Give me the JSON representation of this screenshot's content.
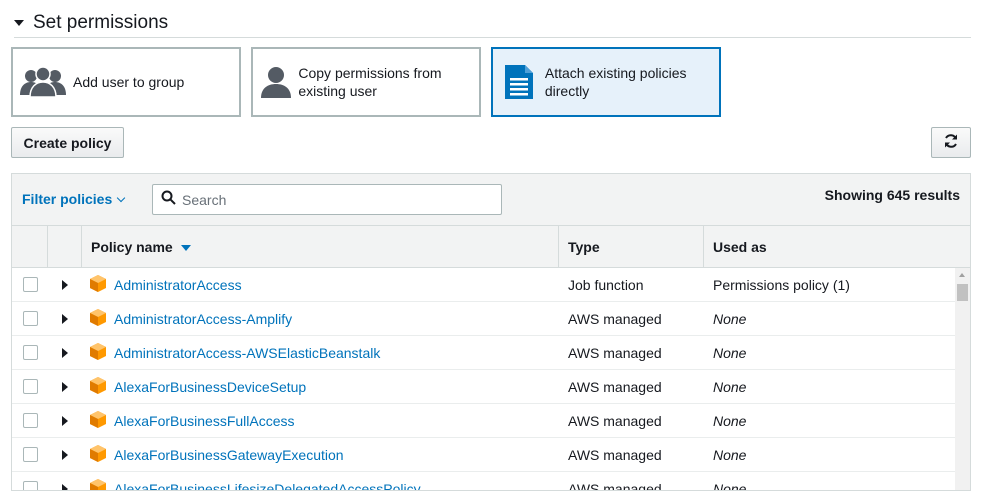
{
  "section": {
    "title": "Set permissions"
  },
  "tiles": [
    {
      "label": "Add user to group",
      "icon": "users-group-icon",
      "selected": false
    },
    {
      "label": "Copy permissions from existing user",
      "icon": "user-icon",
      "selected": false
    },
    {
      "label": "Attach existing policies directly",
      "icon": "document-icon",
      "selected": true
    }
  ],
  "toolbar": {
    "create_label": "Create policy",
    "refresh_icon": "refresh-icon",
    "filter_label": "Filter policies",
    "search_placeholder": "Search",
    "results_text": "Showing 645 results"
  },
  "table": {
    "columns": [
      "Policy name",
      "Type",
      "Used as"
    ],
    "rows": [
      {
        "name": "AdministratorAccess",
        "type": "Job function",
        "used_as": "Permissions policy (1)",
        "used_none": false
      },
      {
        "name": "AdministratorAccess-Amplify",
        "type": "AWS managed",
        "used_as": "None",
        "used_none": true
      },
      {
        "name": "AdministratorAccess-AWSElasticBeanstalk",
        "type": "AWS managed",
        "used_as": "None",
        "used_none": true
      },
      {
        "name": "AlexaForBusinessDeviceSetup",
        "type": "AWS managed",
        "used_as": "None",
        "used_none": true
      },
      {
        "name": "AlexaForBusinessFullAccess",
        "type": "AWS managed",
        "used_as": "None",
        "used_none": true
      },
      {
        "name": "AlexaForBusinessGatewayExecution",
        "type": "AWS managed",
        "used_as": "None",
        "used_none": true
      },
      {
        "name": "AlexaForBusinessLifesizeDelegatedAccessPolicy",
        "type": "AWS managed",
        "used_as": "None",
        "used_none": true
      }
    ]
  },
  "colors": {
    "accent": "#0073bb",
    "policy_icon": "#ff9900",
    "selected_tile_bg": "#e6f1fa"
  }
}
